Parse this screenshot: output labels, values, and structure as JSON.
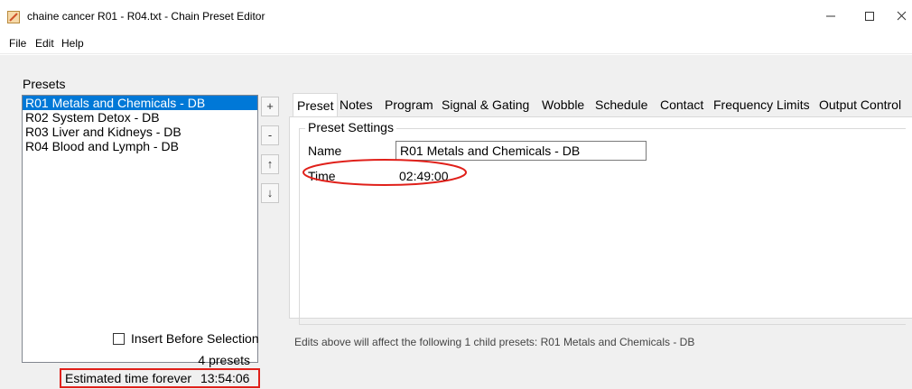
{
  "window": {
    "title": "chaine cancer R01 - R04.txt - Chain Preset Editor",
    "controls": [
      "minimize-icon",
      "maximize-icon",
      "close-icon"
    ]
  },
  "menu": {
    "file": "File",
    "edit": "Edit",
    "help": "Help"
  },
  "presets": {
    "label": "Presets",
    "items": [
      {
        "label": "R01 Metals and Chemicals - DB",
        "selected": true
      },
      {
        "label": "R02 System Detox - DB",
        "selected": false
      },
      {
        "label": "R03 Liver and Kidneys - DB",
        "selected": false
      },
      {
        "label": "R04 Blood and Lymph - DB",
        "selected": false
      }
    ],
    "buttons": {
      "add": "+",
      "remove": "-",
      "up": "↑",
      "down": "↓"
    },
    "insert_before_label": "Insert Before Selection",
    "insert_before_checked": false,
    "count_text": "4 presets",
    "estimated_label": "Estimated time forever",
    "estimated_time": "13:54:06"
  },
  "tabs": [
    "Preset",
    "Notes",
    "Program",
    "Signal & Gating",
    "Wobble",
    "Schedule",
    "Contact",
    "Frequency Limits",
    "Output Control"
  ],
  "active_tab": "Preset",
  "preset_settings": {
    "legend": "Preset Settings",
    "name_label": "Name",
    "name_value": "R01 Metals and Chemicals - DB",
    "time_label": "Time",
    "time_value": "02:49:00"
  },
  "edits_note": "Edits above will affect the following 1 child presets: R01 Metals and Chemicals - DB",
  "colors": {
    "selection": "#0078d7",
    "annotation": "#e0201a",
    "background": "#f0f0f0"
  }
}
